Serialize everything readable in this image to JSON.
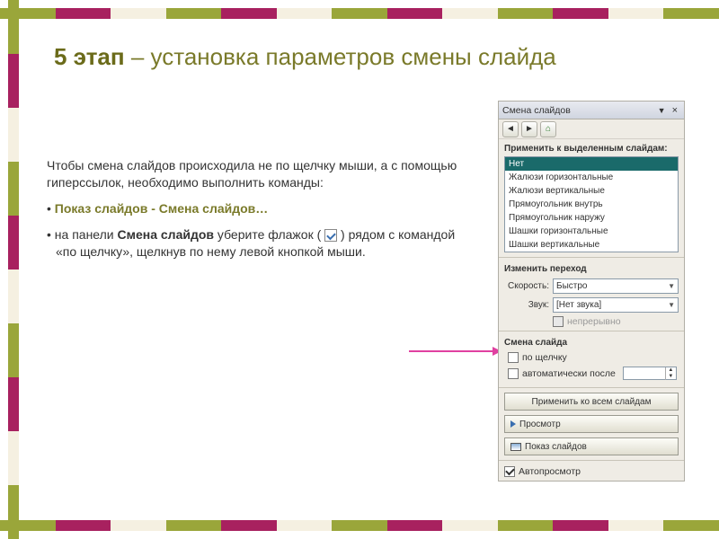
{
  "title": {
    "bold": "5 этап",
    "rest": " – установка параметров смены слайда"
  },
  "content": {
    "p1": "Чтобы смена слайдов происходила не по щелчку мыши, а с помощью гиперссылок, необходимо выполнить команды:",
    "p2": "Показ слайдов - Смена слайдов…",
    "p3a": "• на панели ",
    "p3b": "Смена слайдов",
    "p3c": " уберите флажок ( ",
    "p3d": " ) рядом с командой «по щелчку», щелкнув по нему левой кнопкой мыши."
  },
  "panel": {
    "title": "Смена слайдов",
    "apply_label": "Применить к выделенным слайдам:",
    "effects": [
      "Нет",
      "Жалюзи горизонтальные",
      "Жалюзи вертикальные",
      "Прямоугольник внутрь",
      "Прямоугольник наружу",
      "Шашки горизонтальные",
      "Шашки вертикальные"
    ],
    "change_label": "Изменить переход",
    "speed_label": "Скорость:",
    "speed_value": "Быстро",
    "sound_label": "Звук:",
    "sound_value": "[Нет звука]",
    "loop_label": "непрерывно",
    "advance_label": "Смена слайда",
    "on_click": "по щелчку",
    "auto_after": "автоматически после",
    "apply_all": "Применить ко всем слайдам",
    "preview": "Просмотр",
    "slideshow": "Показ слайдов",
    "autopreview": "Автопросмотр"
  }
}
